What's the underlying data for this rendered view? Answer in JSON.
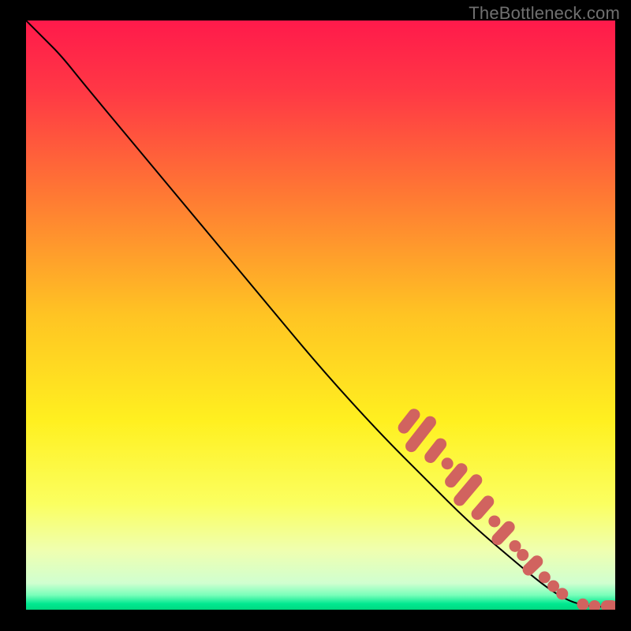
{
  "watermark": "TheBottleneck.com",
  "chart_data": {
    "type": "line",
    "title": "",
    "xlabel": "",
    "ylabel": "",
    "xlim": [
      0,
      100
    ],
    "ylim": [
      0,
      100
    ],
    "grid": false,
    "legend": false,
    "gradient_stops": [
      {
        "offset": 0.0,
        "color": "#ff1a4b"
      },
      {
        "offset": 0.12,
        "color": "#ff3845"
      },
      {
        "offset": 0.3,
        "color": "#ff7a33"
      },
      {
        "offset": 0.5,
        "color": "#ffc423"
      },
      {
        "offset": 0.68,
        "color": "#fff020"
      },
      {
        "offset": 0.82,
        "color": "#fbff60"
      },
      {
        "offset": 0.9,
        "color": "#efffb0"
      },
      {
        "offset": 0.955,
        "color": "#d0ffd0"
      },
      {
        "offset": 0.975,
        "color": "#7affba"
      },
      {
        "offset": 0.99,
        "color": "#00e890"
      },
      {
        "offset": 1.0,
        "color": "#00d880"
      }
    ],
    "curve": [
      {
        "x": 0,
        "y": 100
      },
      {
        "x": 3,
        "y": 97
      },
      {
        "x": 6,
        "y": 94
      },
      {
        "x": 10,
        "y": 89
      },
      {
        "x": 20,
        "y": 77
      },
      {
        "x": 30,
        "y": 65
      },
      {
        "x": 40,
        "y": 53
      },
      {
        "x": 50,
        "y": 41
      },
      {
        "x": 60,
        "y": 30
      },
      {
        "x": 68,
        "y": 22
      },
      {
        "x": 75,
        "y": 15
      },
      {
        "x": 82,
        "y": 9
      },
      {
        "x": 88,
        "y": 4
      },
      {
        "x": 92,
        "y": 1.5
      },
      {
        "x": 95,
        "y": 0.7
      },
      {
        "x": 97,
        "y": 0.5
      },
      {
        "x": 99,
        "y": 0.5
      },
      {
        "x": 100,
        "y": 0.5
      }
    ],
    "markers": [
      {
        "x": 65,
        "y": 32.0,
        "kind": "pill",
        "angle": -52,
        "len": 3.0
      },
      {
        "x": 67,
        "y": 29.8,
        "kind": "pill",
        "angle": -52,
        "len": 4.5
      },
      {
        "x": 69.5,
        "y": 27.0,
        "kind": "pill",
        "angle": -52,
        "len": 3.0
      },
      {
        "x": 71.5,
        "y": 24.8,
        "kind": "dot"
      },
      {
        "x": 73,
        "y": 22.8,
        "kind": "pill",
        "angle": -50,
        "len": 3.0
      },
      {
        "x": 75,
        "y": 20.3,
        "kind": "pill",
        "angle": -50,
        "len": 4.0
      },
      {
        "x": 77.5,
        "y": 17.3,
        "kind": "pill",
        "angle": -49,
        "len": 3.0
      },
      {
        "x": 79.5,
        "y": 15.0,
        "kind": "dot"
      },
      {
        "x": 81,
        "y": 13.0,
        "kind": "pill",
        "angle": -47,
        "len": 3.0
      },
      {
        "x": 83,
        "y": 10.8,
        "kind": "dot"
      },
      {
        "x": 84.3,
        "y": 9.3,
        "kind": "dot"
      },
      {
        "x": 86,
        "y": 7.5,
        "kind": "pill",
        "angle": -44,
        "len": 2.5
      },
      {
        "x": 88,
        "y": 5.5,
        "kind": "dot"
      },
      {
        "x": 89.5,
        "y": 4.0,
        "kind": "dot"
      },
      {
        "x": 91,
        "y": 2.7,
        "kind": "dot"
      },
      {
        "x": 94.5,
        "y": 0.9,
        "kind": "dot"
      },
      {
        "x": 96.5,
        "y": 0.6,
        "kind": "dot"
      },
      {
        "x": 99.0,
        "y": 0.6,
        "kind": "pill",
        "angle": 0,
        "len": 1.8
      }
    ],
    "marker_color": "#d1635f",
    "curve_color": "#000000"
  }
}
